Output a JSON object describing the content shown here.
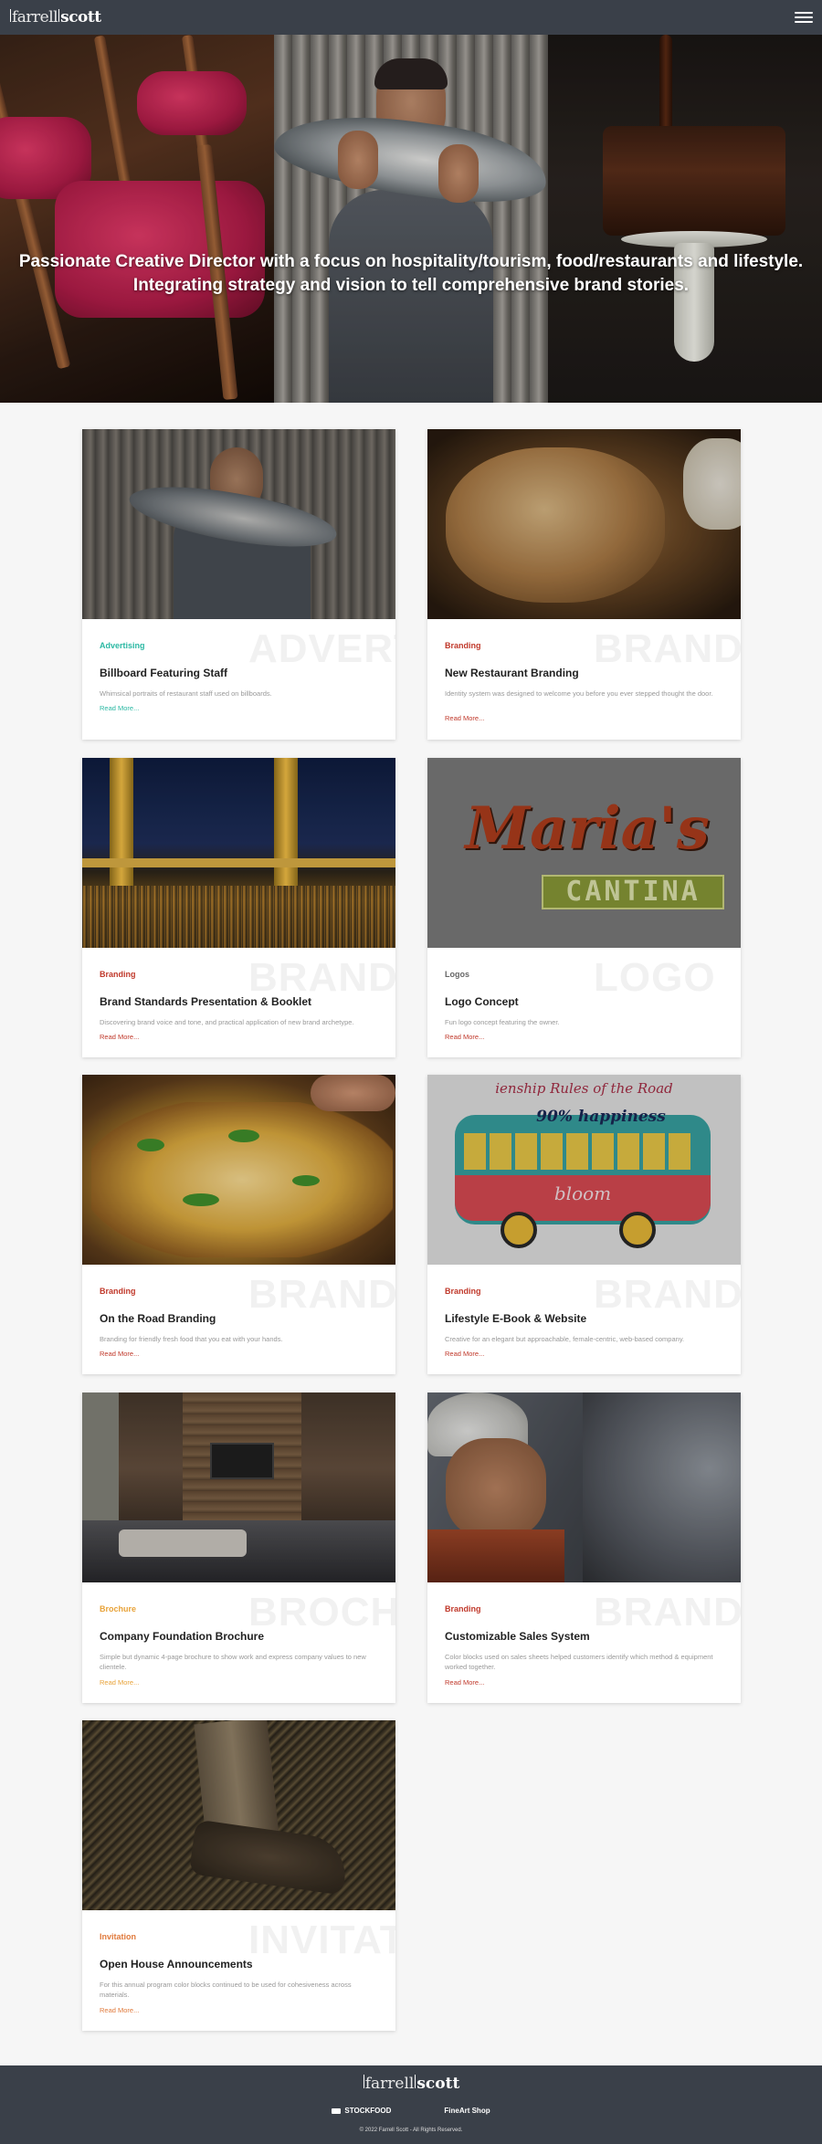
{
  "nav": {
    "logo_part1": "farrell",
    "logo_part2": "scott",
    "menu_icon": "hamburger-menu-icon"
  },
  "hero": {
    "tagline_line1": "Passionate Creative Director with a focus on hospitality/tourism, food/restaurants and lifestyle.",
    "tagline_line2": "Integrating strategy and vision to tell comprehensive brand stories."
  },
  "colors": {
    "advertising": "#2bb8a3",
    "branding": "#c0392b",
    "logos": "#666666",
    "brochure": "#e8a33a",
    "invitation": "#e07a3c",
    "nav_bg": "#3a4049"
  },
  "cards": [
    {
      "category": "Advertising",
      "watermark": "ADVERTI",
      "title": "Billboard Featuring Staff",
      "description": "Whimsical portraits of restaurant staff used on billboards.",
      "read_more": "Read More..."
    },
    {
      "category": "Branding",
      "watermark": "BRAND",
      "title": "New Restaurant Branding",
      "description": "Identity system was designed to welcome you before you ever stepped thought the door.",
      "read_more": "Read More..."
    },
    {
      "category": "Branding",
      "watermark": "BRAND",
      "title": "Brand Standards Presentation & Booklet",
      "description": "Discovering brand voice and tone, and practical application of new brand archetype.",
      "read_more": "Read More..."
    },
    {
      "category": "Logos",
      "watermark": "LOGO",
      "title": "Logo Concept",
      "description": "Fun logo concept featuring the owner.",
      "read_more": "Read More...",
      "image_text1": "Maria's",
      "image_text2": "CANTINA"
    },
    {
      "category": "Branding",
      "watermark": "BRAND",
      "title": "On the Road Branding",
      "description": "Branding for friendly fresh food that you eat with your hands.",
      "read_more": "Read More..."
    },
    {
      "category": "Branding",
      "watermark": "BRAND",
      "title": "Lifestyle E-Book & Website",
      "description": "Creative for an elegant but approachable, female-centric, web-based company.",
      "read_more": "Read More...",
      "image_text1": "ienship Rules of the Road",
      "image_text2": "90% happiness",
      "image_text3": "bloom"
    },
    {
      "category": "Brochure",
      "watermark": "BROCHU",
      "title": "Company Foundation Brochure",
      "description": "Simple but dynamic 4-page brochure to show work and express company values to new clientele.",
      "read_more": "Read More..."
    },
    {
      "category": "Branding",
      "watermark": "BRAND",
      "title": "Customizable Sales System",
      "description": "Color blocks used on sales sheets helped customers identify which method & equipment worked together.",
      "read_more": "Read More..."
    },
    {
      "category": "Invitation",
      "watermark": "INVITAT",
      "title": "Open House Announcements",
      "description": "For this annual program color blocks continued to be used for cohesiveness across materials.",
      "read_more": "Read More..."
    }
  ],
  "footer": {
    "logo_part1": "farrell",
    "logo_part2": "scott",
    "link1": "STOCKFOOD",
    "link2": "FineArt Shop",
    "copyright": "© 2022 Farrell Scott - All Rights Reserved."
  }
}
